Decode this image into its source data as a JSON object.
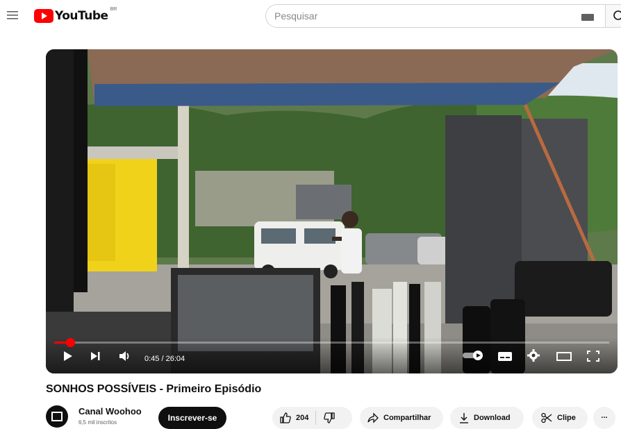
{
  "header": {
    "logo_text": "YouTube",
    "logo_country": "BR",
    "search_placeholder": "Pesquisar"
  },
  "player": {
    "time_current": "0:45",
    "time_total": "26:04",
    "time_display": "0:45 / 26:04",
    "progress_fraction": 0.029,
    "autoplay_on": true
  },
  "video": {
    "title": "SONHOS POSSÍVEIS - Primeiro Episódio"
  },
  "channel": {
    "name": "Canal Woohoo",
    "subscribers": "6,5 mil inscritos",
    "subscribe_label": "Inscrever-se"
  },
  "actions": {
    "like_count": "204",
    "share_label": "Compartilhar",
    "download_label": "Download",
    "clip_label": "Clipe",
    "more_label": "..."
  },
  "colors": {
    "brand_red": "#ff0000",
    "text_primary": "#0f0f0f",
    "chip_bg": "#f2f2f2"
  }
}
